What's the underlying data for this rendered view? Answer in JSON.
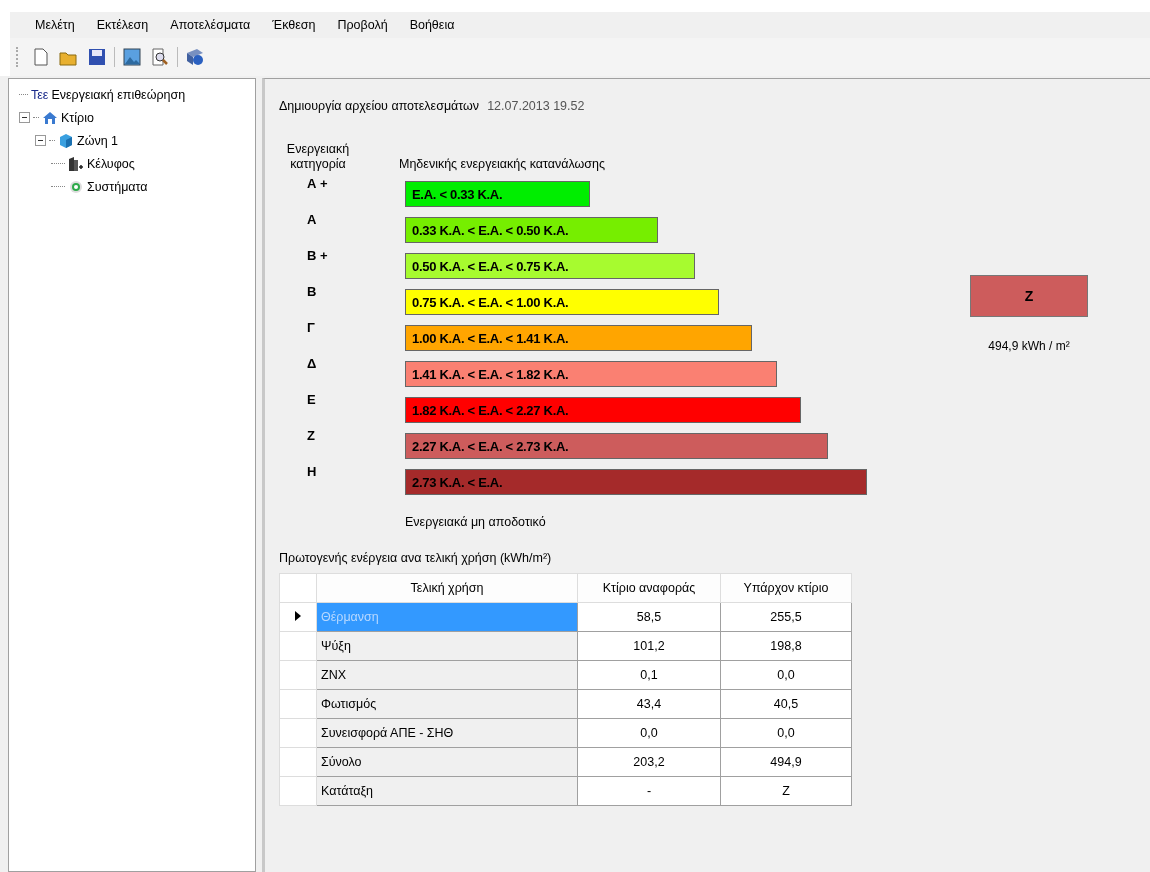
{
  "menu": [
    "Μελέτη",
    "Εκτέλεση",
    "Αποτελέσματα",
    "Έκθεση",
    "Προβολή",
    "Βοήθεια"
  ],
  "toolbar": [
    {
      "kind": "new"
    },
    {
      "kind": "open"
    },
    {
      "kind": "save"
    },
    {
      "kind": "sep"
    },
    {
      "kind": "image"
    },
    {
      "kind": "preview"
    },
    {
      "kind": "sep"
    },
    {
      "kind": "help"
    }
  ],
  "tree": [
    {
      "logo": "Τεε",
      "label": "Ενεργειακή επιθεώρηση",
      "kind": "root"
    },
    {
      "label": "Κτίριο",
      "kind": "building",
      "expanded": true,
      "children": [
        {
          "label": "Ζώνη 1",
          "kind": "zone",
          "expanded": true,
          "children": [
            {
              "label": "Κέλυφος",
              "kind": "shell"
            },
            {
              "label": "Συστήματα",
              "kind": "systems"
            }
          ]
        }
      ]
    }
  ],
  "results": {
    "created_label": "Δημιουργία αρχείου αποτελεσμάτων",
    "created_value": "12.07.2013 19.52",
    "category_header": "Ενεργειακή κατηγορία",
    "top_caption": "Μηδενικής ενεργειακής κατανάλωσης",
    "bottom_caption": "Ενεργειακά μη αποδοτικό",
    "classes": [
      {
        "grade": "Α +",
        "range": "Ε.Α. < 0.33 Κ.Α.",
        "color": "#00ee00"
      },
      {
        "grade": "Α",
        "range": "0.33 Κ.Α. <  Ε.Α. < 0.50 Κ.Α.",
        "color": "#76ee00"
      },
      {
        "grade": "Β +",
        "range": "0.50 Κ.Α. <  Ε.Α. < 0.75 Κ.Α.",
        "color": "#a7fb2f"
      },
      {
        "grade": "Β",
        "range": "0.75 Κ.Α. <  Ε.Α. < 1.00 Κ.Α.",
        "color": "#ffff00"
      },
      {
        "grade": "Γ",
        "range": "1.00 Κ.Α. <  Ε.Α. < 1.41 Κ.Α.",
        "color": "#ffa500"
      },
      {
        "grade": "Δ",
        "range": "1.41 Κ.Α. <  Ε.Α. < 1.82 Κ.Α.",
        "color": "#fa8072"
      },
      {
        "grade": "Ε",
        "range": "1.82 Κ.Α. <  Ε.Α. < 2.27 Κ.Α.",
        "color": "#ff0000"
      },
      {
        "grade": "Ζ",
        "range": "2.27 Κ.Α. <  Ε.Α. < 2.73 Κ.Α.",
        "color": "#cd5c5c"
      },
      {
        "grade": "Η",
        "range": "2.73 Κ.Α. <  Ε.Α.",
        "color": "#a52a2a"
      }
    ],
    "rating": {
      "grade": "Ζ",
      "color": "#cd5c5c",
      "value": "494,9 kWh / m²"
    }
  },
  "table": {
    "title": "Πρωτογενής ενέργεια ανα τελική χρήση (kWh/m²)",
    "columns": [
      "Τελική χρήση",
      "Κτίριο αναφοράς",
      "Υπάρχον κτίριο"
    ],
    "rows": [
      {
        "cells": [
          "Θέρμανση",
          "58,5",
          "255,5"
        ],
        "selected": true
      },
      {
        "cells": [
          "Ψύξη",
          "101,2",
          "198,8"
        ],
        "selected": false
      },
      {
        "cells": [
          "ΖΝΧ",
          "0,1",
          "0,0"
        ],
        "selected": false
      },
      {
        "cells": [
          "Φωτισμός",
          "43,4",
          "40,5"
        ],
        "selected": false
      },
      {
        "cells": [
          "Συνεισφορά ΑΠΕ - ΣΗΘ",
          "0,0",
          "0,0"
        ],
        "selected": false
      },
      {
        "cells": [
          "Σύνολο",
          "203,2",
          "494,9"
        ],
        "selected": false
      },
      {
        "cells": [
          "Κατάταξη",
          "-",
          "Ζ"
        ],
        "selected": false
      }
    ]
  }
}
